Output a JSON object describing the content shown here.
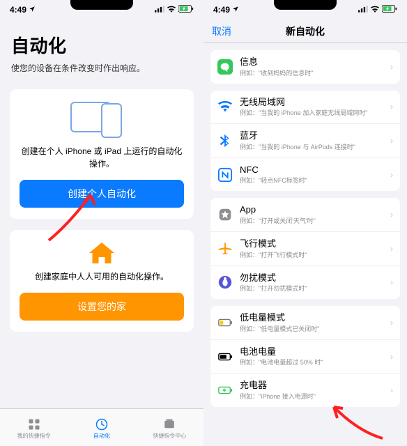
{
  "statusbar": {
    "time": "4:49"
  },
  "left": {
    "title": "自动化",
    "subtitle": "使您的设备在条件改变时作出响应。",
    "card1_desc": "创建在个人 iPhone 或 iPad 上运行的自动化操作。",
    "card1_btn": "创建个人自动化",
    "card2_desc": "创建家庭中人人可用的自动化操作。",
    "card2_btn": "设置您的家",
    "tabs": {
      "t1": "我的快捷指令",
      "t2": "自动化",
      "t3": "快捷指令中心"
    }
  },
  "right": {
    "cancel": "取消",
    "title": "新自动化",
    "groups": [
      [
        {
          "icon": "message",
          "title": "信息",
          "sub": "例如：\"收到妈妈的信息时\""
        }
      ],
      [
        {
          "icon": "wifi",
          "title": "无线局域网",
          "sub": "例如：\"当我的 iPhone 加入家庭无线局域网时\""
        },
        {
          "icon": "bluetooth",
          "title": "蓝牙",
          "sub": "例如：\"当我的 iPhone 与 AirPods 连接时\""
        },
        {
          "icon": "nfc",
          "title": "NFC",
          "sub": "例如：\"轻点NFC标签时\""
        }
      ],
      [
        {
          "icon": "app",
          "title": "App",
          "sub": "例如：\"打开或关闭'天气'时\""
        },
        {
          "icon": "airplane",
          "title": "飞行模式",
          "sub": "例如：\"打开飞行模式时\""
        },
        {
          "icon": "dnd",
          "title": "勿扰模式",
          "sub": "例如：\"打开勿扰模式时\""
        }
      ],
      [
        {
          "icon": "lowbatt",
          "title": "低电量模式",
          "sub": "例如：\"低电量模式已关闭时\""
        },
        {
          "icon": "battery",
          "title": "电池电量",
          "sub": "例如：\"电池电量超过 50% 时\""
        },
        {
          "icon": "charger",
          "title": "充电器",
          "sub": "例如：\"iPhone 接入电源时\""
        }
      ]
    ]
  }
}
